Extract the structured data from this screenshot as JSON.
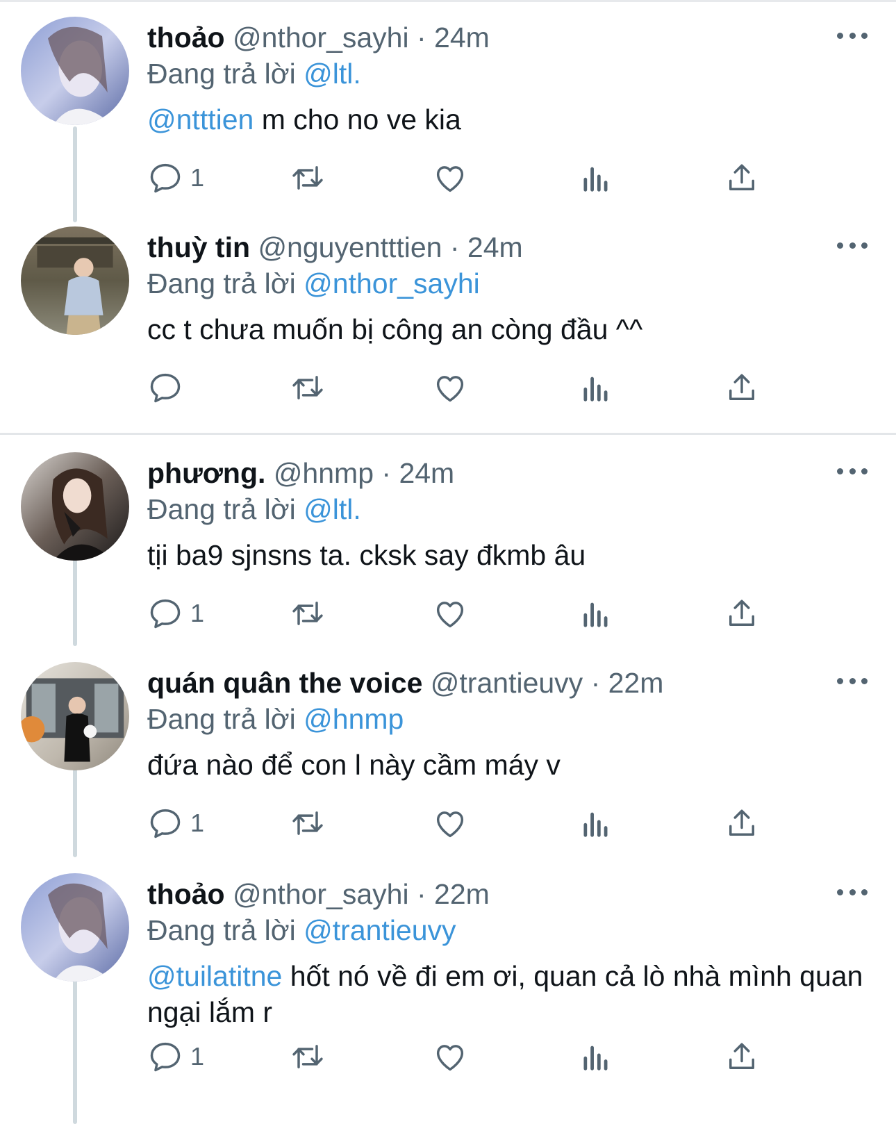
{
  "tweets": [
    {
      "name": "thoảo",
      "handle": "@nthor_sayhi",
      "time": "· 24m",
      "reply_prefix": "Đang trả lời",
      "reply_to": "@ltl.",
      "mention": "@ntttien",
      "text": " m cho no ve kia",
      "reply_count": "1",
      "avatar": "avatar-blue-portrait"
    },
    {
      "name": "thuỳ tin",
      "handle": "@nguyentttien",
      "time": "· 24m",
      "reply_prefix": "Đang trả lời",
      "reply_to": "@nthor_sayhi",
      "mention": "",
      "text": "cc t chưa muốn bị công an còng đầu ^^",
      "reply_count": "",
      "avatar": "avatar-outdoor-portrait"
    },
    {
      "name": "phương.",
      "handle": "@hnmp",
      "time": "· 24m",
      "reply_prefix": "Đang trả lời",
      "reply_to": "@ltl.",
      "mention": "",
      "text": "tịi ba9 sjnsns ta. cksk say đkmb âu",
      "reply_count": "1",
      "avatar": "avatar-dark-portrait"
    },
    {
      "name": "quán quân the voice",
      "handle": "@trantieuvy",
      "time": "· 22m",
      "reply_prefix": "Đang trả lời",
      "reply_to": "@hnmp",
      "mention": "",
      "text": "đứa nào để con l này cầm máy v",
      "reply_count": "1",
      "avatar": "avatar-storefront-portrait"
    },
    {
      "name": "thoảo",
      "handle": "@nthor_sayhi",
      "time": "· 22m",
      "reply_prefix": "Đang trả lời",
      "reply_to": "@trantieuvy",
      "mention": "@tuilatitne",
      "text": " hốt nó về đi em ơi, quan cả lò nhà mình quan ngại lắm r",
      "reply_count": "1",
      "avatar": "avatar-blue-portrait"
    }
  ],
  "icons": [
    "reply-icon",
    "retweet-icon",
    "like-icon",
    "analytics-icon",
    "share-icon",
    "more-icon"
  ],
  "colors": {
    "link": "#3b94d9",
    "secondary_text": "#536471",
    "primary_text": "#0f1419",
    "thread_line": "#cfd9de",
    "divider": "#e3e6e9"
  }
}
